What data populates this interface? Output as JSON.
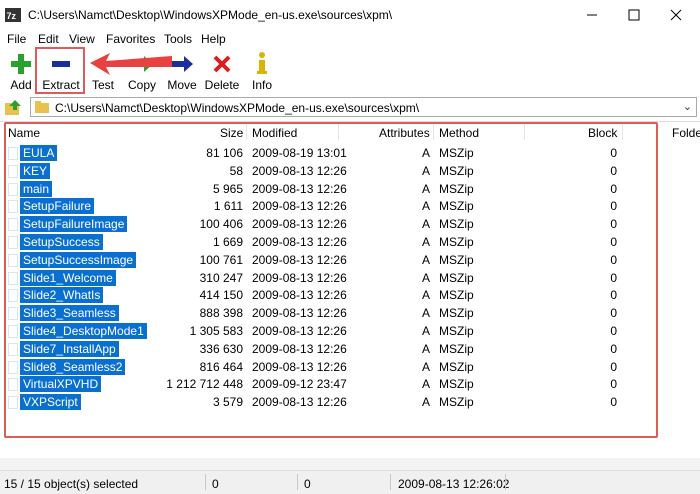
{
  "window": {
    "title": "C:\\Users\\Namct\\Desktop\\WindowsXPMode_en-us.exe\\sources\\xpm\\"
  },
  "menu": [
    "File",
    "Edit",
    "View",
    "Favorites",
    "Tools",
    "Help"
  ],
  "toolbar": {
    "add": "Add",
    "extract": "Extract",
    "test": "Test",
    "copy": "Copy",
    "move": "Move",
    "delete": "Delete",
    "info": "Info"
  },
  "address": {
    "path": "C:\\Users\\Namct\\Desktop\\WindowsXPMode_en-us.exe\\sources\\xpm\\"
  },
  "columns": [
    "Name",
    "Size",
    "Modified",
    "Attributes",
    "Method",
    "Block",
    "Folde"
  ],
  "files": [
    {
      "name": "EULA",
      "size": "81 106",
      "modified": "2009-08-19 13:01",
      "attributes": "A",
      "method": "MSZip",
      "block": "0"
    },
    {
      "name": "KEY",
      "size": "58",
      "modified": "2009-08-13 12:26",
      "attributes": "A",
      "method": "MSZip",
      "block": "0"
    },
    {
      "name": "main",
      "size": "5 965",
      "modified": "2009-08-13 12:26",
      "attributes": "A",
      "method": "MSZip",
      "block": "0"
    },
    {
      "name": "SetupFailure",
      "size": "1 611",
      "modified": "2009-08-13 12:26",
      "attributes": "A",
      "method": "MSZip",
      "block": "0"
    },
    {
      "name": "SetupFailureImage",
      "size": "100 406",
      "modified": "2009-08-13 12:26",
      "attributes": "A",
      "method": "MSZip",
      "block": "0"
    },
    {
      "name": "SetupSuccess",
      "size": "1 669",
      "modified": "2009-08-13 12:26",
      "attributes": "A",
      "method": "MSZip",
      "block": "0"
    },
    {
      "name": "SetupSuccessImage",
      "size": "100 761",
      "modified": "2009-08-13 12:26",
      "attributes": "A",
      "method": "MSZip",
      "block": "0"
    },
    {
      "name": "Slide1_Welcome",
      "size": "310 247",
      "modified": "2009-08-13 12:26",
      "attributes": "A",
      "method": "MSZip",
      "block": "0"
    },
    {
      "name": "Slide2_WhatIs",
      "size": "414 150",
      "modified": "2009-08-13 12:26",
      "attributes": "A",
      "method": "MSZip",
      "block": "0"
    },
    {
      "name": "Slide3_Seamless",
      "size": "888 398",
      "modified": "2009-08-13 12:26",
      "attributes": "A",
      "method": "MSZip",
      "block": "0"
    },
    {
      "name": "Slide4_DesktopMode1",
      "size": "1 305 583",
      "modified": "2009-08-13 12:26",
      "attributes": "A",
      "method": "MSZip",
      "block": "0"
    },
    {
      "name": "Slide7_InstallApp",
      "size": "336 630",
      "modified": "2009-08-13 12:26",
      "attributes": "A",
      "method": "MSZip",
      "block": "0"
    },
    {
      "name": "Slide8_Seamless2",
      "size": "816 464",
      "modified": "2009-08-13 12:26",
      "attributes": "A",
      "method": "MSZip",
      "block": "0"
    },
    {
      "name": "VirtualXPVHD",
      "size": "1 212 712 448",
      "modified": "2009-09-12 23:47",
      "attributes": "A",
      "method": "MSZip",
      "block": "0"
    },
    {
      "name": "VXPScript",
      "size": "3 579",
      "modified": "2009-08-13 12:26",
      "attributes": "A",
      "method": "MSZip",
      "block": "0"
    }
  ],
  "status": {
    "selected": "15 / 15 object(s) selected",
    "field1": "0",
    "field2": "0",
    "date": "2009-08-13 12:26:02"
  },
  "colors": {
    "selection": "#0a70d0",
    "highlight_border": "#e05a5a",
    "arrow": "#e8413f"
  },
  "icons": [
    "app-icon",
    "minimize-icon",
    "maximize-icon",
    "close-icon",
    "add-icon",
    "extract-icon",
    "test-icon",
    "copy-icon",
    "move-icon",
    "delete-icon",
    "info-icon",
    "up-folder-icon",
    "folder-icon",
    "chevron-down-icon",
    "file-icon"
  ]
}
